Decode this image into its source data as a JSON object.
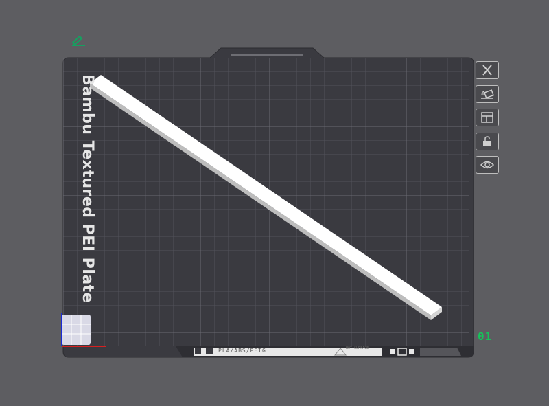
{
  "plate": {
    "name": "Bambu Textured PEI Plate",
    "number": "01",
    "filament_label": "PLA/ABS/PETG",
    "hot_surface_label": "HOT SURFACE"
  },
  "toolbar": {
    "items": [
      {
        "icon": "close-icon"
      },
      {
        "icon": "auto-orient-icon"
      },
      {
        "icon": "arrange-icon"
      },
      {
        "icon": "lock-icon"
      },
      {
        "icon": "eye-icon"
      }
    ]
  },
  "colors": {
    "background": "#5d5d61",
    "plate": "#3a3a40",
    "grid": "#55555c",
    "model": "#ffffff",
    "accent": "#16c25a"
  }
}
